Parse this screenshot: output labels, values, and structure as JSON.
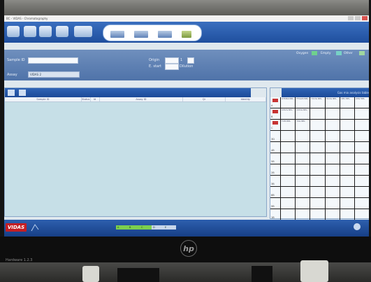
{
  "window": {
    "title": "BC - VIDAS - Chromatography"
  },
  "form": {
    "sample_id_label": "Sample ID",
    "assay_label": "Assay",
    "assay_value": "VIDAS 2",
    "origin_label": "Origin",
    "entry_label": "E. start",
    "dilution_label": "Dilution",
    "extra_label": "1"
  },
  "legend": {
    "items": [
      {
        "label": "Oxygen",
        "color": "#6fd18d"
      },
      {
        "label": "Empty",
        "color": "#77d1c6"
      },
      {
        "label": "Other",
        "color": "#9fd7a0"
      }
    ]
  },
  "list_panel": {
    "columns": [
      "Sample ID",
      "Status",
      "Id",
      "Assay ID",
      "Qr",
      "Identity"
    ]
  },
  "grid_panel": {
    "caption": "Gas mix analysis table",
    "rows": [
      {
        "label": "A",
        "flagged": true,
        "cells": [
          "OTM60 BEL",
          "FFOAM BEL",
          "HCVG BEL",
          "HCVG BEL",
          "CMV BEL",
          "CMV BEL"
        ]
      },
      {
        "label": "B",
        "flagged": true,
        "cells": [
          "CMVG BEL",
          "CMVG BEL",
          "",
          "",
          "",
          ""
        ]
      },
      {
        "label": "C",
        "flagged": true,
        "cells": [
          "TXM BEL",
          "TXG BEL",
          "",
          "",
          "",
          ""
        ]
      },
      {
        "label": "3D",
        "flagged": false,
        "cells": [
          "",
          "",
          "",
          "",
          "",
          ""
        ]
      },
      {
        "label": "4B",
        "flagged": false,
        "cells": [
          "",
          "",
          "",
          "",
          "",
          ""
        ]
      },
      {
        "label": "5B",
        "flagged": false,
        "cells": [
          "",
          "",
          "",
          "",
          "",
          ""
        ]
      },
      {
        "label": "2B",
        "flagged": false,
        "cells": [
          "",
          "",
          "",
          "",
          "",
          ""
        ]
      },
      {
        "label": "3B",
        "flagged": false,
        "cells": [
          "",
          "",
          "",
          "",
          "",
          ""
        ]
      },
      {
        "label": "8B",
        "flagged": false,
        "cells": [
          "",
          "",
          "",
          "",
          "",
          ""
        ]
      },
      {
        "label": "9B",
        "flagged": false,
        "cells": [
          "",
          "",
          "",
          "",
          "",
          ""
        ]
      },
      {
        "label": "1B",
        "flagged": false,
        "cells": [
          "",
          "",
          "",
          "",
          "",
          ""
        ]
      }
    ]
  },
  "statusbar": {
    "logo": "VIDAS",
    "modules": [
      {
        "label": "A",
        "state": "ok"
      },
      {
        "label": "B",
        "state": "ok"
      },
      {
        "label": "C",
        "state": "ok"
      },
      {
        "label": "D",
        "state": "off"
      },
      {
        "label": "E",
        "state": "off"
      }
    ]
  },
  "device": {
    "brand": "hp",
    "screen_label": "Hardware 1.2.3"
  }
}
